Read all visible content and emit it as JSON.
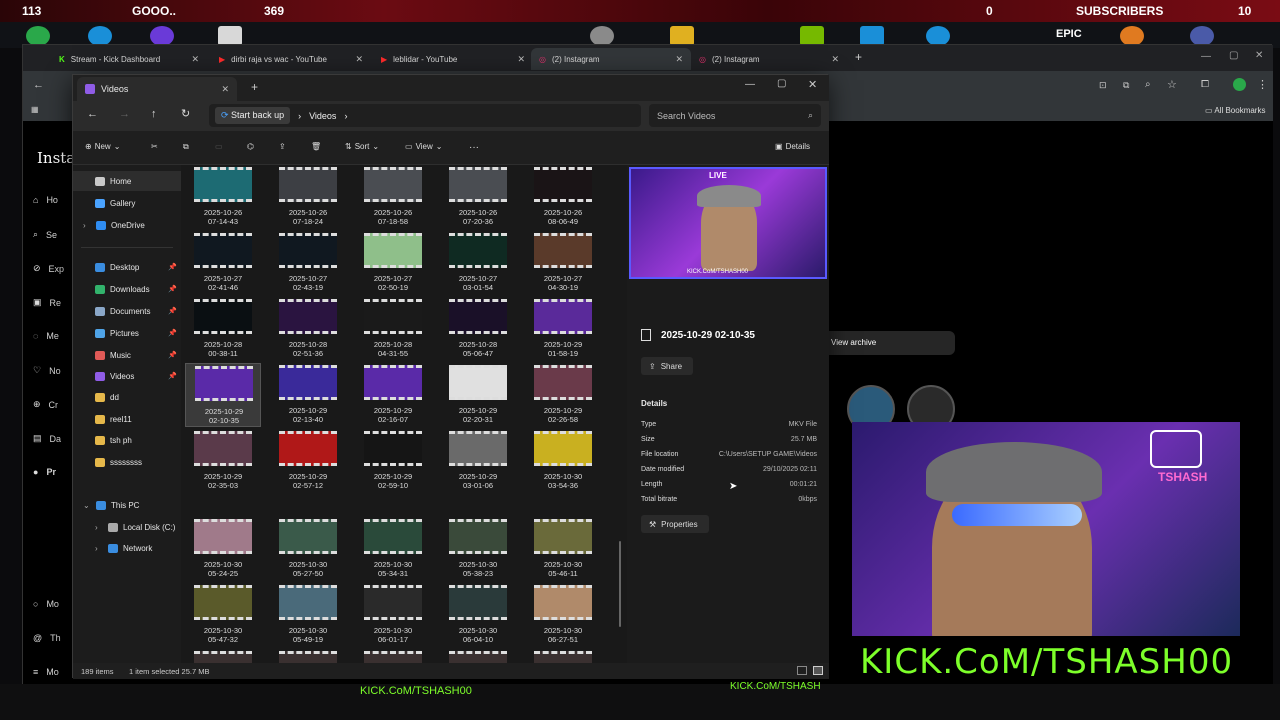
{
  "overlay": {
    "left_count": "113",
    "goal": "GOOO..",
    "mid_count": "369",
    "zero": "0",
    "subs_label": "SUBSCRIBERS",
    "subs_count": "10",
    "epic": "EPIC"
  },
  "browser": {
    "tabs": [
      {
        "label": "Stream - Kick Dashboard"
      },
      {
        "label": "dirbi raja vs wac - YouTube"
      },
      {
        "label": "leblidar - YouTube"
      },
      {
        "label": "(2) Instagram"
      },
      {
        "label": "(2) Instagram"
      }
    ],
    "new_tab": "+",
    "all_bookmarks": "All Bookmarks",
    "view_archive": "View archive"
  },
  "instagram": {
    "logo": "Instag",
    "nav": [
      "Ho",
      "Se",
      "Exp",
      "Re",
      "Me",
      "No",
      "Cr",
      "Da",
      "Pr",
      "Mo",
      "Th",
      "Mo"
    ]
  },
  "explorer": {
    "tab_title": "Videos",
    "start_back_up": "Start back up",
    "breadcrumb": "Videos",
    "search_placeholder": "Search Videos",
    "toolbar": {
      "new": "New",
      "sort": "Sort",
      "view": "View",
      "details": "Details",
      "more": "···"
    },
    "sidebar": [
      {
        "label": "Home",
        "icon": "home-icon",
        "color": "#c9c9c9"
      },
      {
        "label": "Gallery",
        "icon": "gallery-icon",
        "color": "#4aa3ff"
      },
      {
        "label": "OneDrive",
        "icon": "onedrive-icon",
        "color": "#2f8df2"
      },
      {
        "label": "Desktop",
        "icon": "desktop-icon",
        "color": "#3a8de0",
        "pinned": true
      },
      {
        "label": "Downloads",
        "icon": "downloads-icon",
        "color": "#32b36c",
        "pinned": true
      },
      {
        "label": "Documents",
        "icon": "documents-icon",
        "color": "#8aa7c8",
        "pinned": true
      },
      {
        "label": "Pictures",
        "icon": "pictures-icon",
        "color": "#4fa4e8",
        "pinned": true
      },
      {
        "label": "Music",
        "icon": "music-icon",
        "color": "#e15a57",
        "pinned": true
      },
      {
        "label": "Videos",
        "icon": "videos-icon",
        "color": "#8f5ce6",
        "pinned": true
      },
      {
        "label": "dd",
        "icon": "folder-icon",
        "color": "#e6b84a"
      },
      {
        "label": "reel11",
        "icon": "folder-icon",
        "color": "#e6b84a"
      },
      {
        "label": "tsh ph",
        "icon": "folder-icon",
        "color": "#e6b84a"
      },
      {
        "label": "ssssssss",
        "icon": "folder-icon",
        "color": "#e6b84a"
      },
      {
        "label": "This PC",
        "icon": "pc-icon",
        "color": "#3a8de0"
      },
      {
        "label": "Local Disk (C:)",
        "icon": "disk-icon",
        "color": "#aaaaaa"
      },
      {
        "label": "Network",
        "icon": "network-icon",
        "color": "#3a8de0"
      }
    ],
    "files": [
      {
        "date": "2025-10-26",
        "time": "07-14-43",
        "color": "#1d6b73"
      },
      {
        "date": "2025-10-26",
        "time": "07-18-24",
        "color": "#3d3f44"
      },
      {
        "date": "2025-10-26",
        "time": "07-18-58",
        "color": "#4a4d52"
      },
      {
        "date": "2025-10-26",
        "time": "07-20-36",
        "color": "#4a4d52"
      },
      {
        "date": "2025-10-26",
        "time": "08-06-49",
        "color": "#1a1416"
      },
      {
        "date": "2025-10-27",
        "time": "02-41-46",
        "color": "#101820"
      },
      {
        "date": "2025-10-27",
        "time": "02-43-19",
        "color": "#101820"
      },
      {
        "date": "2025-10-27",
        "time": "02-50-19",
        "color": "#8fbf8a"
      },
      {
        "date": "2025-10-27",
        "time": "03-01-54",
        "color": "#0f2a22"
      },
      {
        "date": "2025-10-27",
        "time": "04-30-19",
        "color": "#5a3a2a"
      },
      {
        "date": "2025-10-28",
        "time": "00-38-11",
        "color": "#0a0f12"
      },
      {
        "date": "2025-10-28",
        "time": "02-51-36",
        "color": "#2a1440"
      },
      {
        "date": "2025-10-28",
        "time": "04-31-55",
        "color": "#1a1a1a"
      },
      {
        "date": "2025-10-28",
        "time": "05-06-47",
        "color": "#1a1028"
      },
      {
        "date": "2025-10-29",
        "time": "01-58-19",
        "color": "#5a2a9a"
      },
      {
        "date": "2025-10-29",
        "time": "02-10-35",
        "color": "#5a2aa8",
        "selected": true
      },
      {
        "date": "2025-10-29",
        "time": "02-13-40",
        "color": "#3a2a9a"
      },
      {
        "date": "2025-10-29",
        "time": "02-16-07",
        "color": "#5a2aa8"
      },
      {
        "date": "2025-10-29",
        "time": "02-20-31",
        "color": "#e0e0e0"
      },
      {
        "date": "2025-10-29",
        "time": "02-26-58",
        "color": "#6a3a4a"
      },
      {
        "date": "2025-10-29",
        "time": "02-35-03",
        "color": "#5a3a4a"
      },
      {
        "date": "2025-10-29",
        "time": "02-57-12",
        "color": "#b01818"
      },
      {
        "date": "2025-10-29",
        "time": "02-59-10",
        "color": "#151515"
      },
      {
        "date": "2025-10-29",
        "time": "03-01-06",
        "color": "#6a6a6a"
      },
      {
        "date": "2025-10-30",
        "time": "03-54-36",
        "color": "#c9b020"
      },
      {
        "date": "2025-10-30",
        "time": "05-24-25",
        "color": "#a07a8a"
      },
      {
        "date": "2025-10-30",
        "time": "05-27-50",
        "color": "#3a5a4a"
      },
      {
        "date": "2025-10-30",
        "time": "05-34-31",
        "color": "#2a4a3a"
      },
      {
        "date": "2025-10-30",
        "time": "05-38-23",
        "color": "#3a4a3a"
      },
      {
        "date": "2025-10-30",
        "time": "05-46-11",
        "color": "#6a6a3a"
      },
      {
        "date": "2025-10-30",
        "time": "05-47-32",
        "color": "#5a5a2a"
      },
      {
        "date": "2025-10-30",
        "time": "05-49-19",
        "color": "#4a6a7a"
      },
      {
        "date": "2025-10-30",
        "time": "06-01-17",
        "color": "#2a2a2a"
      },
      {
        "date": "2025-10-30",
        "time": "06-04-10",
        "color": "#2a3a3a"
      },
      {
        "date": "2025-10-30",
        "time": "06-27-51",
        "color": "#b08a6a"
      }
    ],
    "details": {
      "filename": "2025-10-29 02-10-35",
      "share": "Share",
      "heading": "Details",
      "rows": [
        {
          "k": "Type",
          "v": "MKV File"
        },
        {
          "k": "Size",
          "v": "25.7 MB"
        },
        {
          "k": "File location",
          "v": "C:\\Users\\SETUP GAME\\Videos"
        },
        {
          "k": "Date modified",
          "v": "29/10/2025 02:11"
        },
        {
          "k": "Length",
          "v": "00:01:21"
        },
        {
          "k": "Total bitrate",
          "v": "0kbps"
        }
      ],
      "properties": "Properties",
      "preview_live": "LIVE",
      "preview_text": "KICK.CoM/TSHASH00"
    },
    "status": {
      "items": "189 items",
      "selected": "1 item selected  25.7 MB"
    }
  },
  "stream": {
    "banner": "KICK.CoM/TSHASH00",
    "bottom_left": "KICK.CoM/TSHASH00",
    "bottom_right": "KICK.CoM/TSHASH",
    "badge": "TSHASH"
  }
}
